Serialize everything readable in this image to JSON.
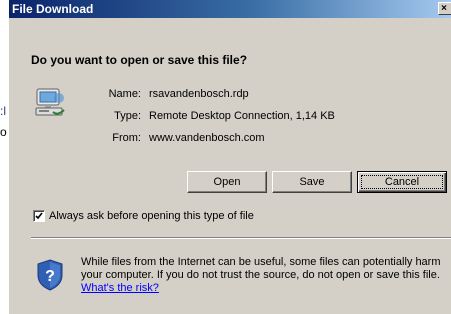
{
  "background": {
    "fragment_a": ":l",
    "fragment_b": "o"
  },
  "dialog": {
    "title": "File Download",
    "close_label": "×",
    "question": "Do you want to open or save this file?",
    "file": {
      "name_label": "Name:",
      "name_value": "rsavandenbosch.rdp",
      "type_label": "Type:",
      "type_value": "Remote Desktop Connection, 1,14 KB",
      "from_label": "From:",
      "from_value": "www.vandenbosch.com"
    },
    "buttons": {
      "open_label": "Open",
      "save_label": "Save",
      "cancel_label": "Cancel"
    },
    "always_ask": {
      "label": "Always ask before opening this type of file",
      "checked": true
    },
    "warning": {
      "text": "While files from the Internet can be useful, some files can potentially harm your computer. If you do not trust the source, do not open or save this file.",
      "link": "What's the risk?"
    },
    "colors": {
      "titlebar_start": "#0a246a",
      "titlebar_end": "#a6caf0",
      "face": "#d4d0c8",
      "link": "#0000ff"
    },
    "icons": [
      "computer-icon",
      "checkmark-icon",
      "shield-question-icon",
      "close-icon"
    ]
  }
}
